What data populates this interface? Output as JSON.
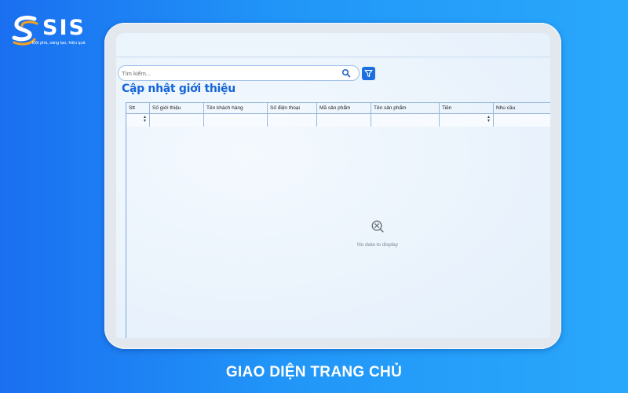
{
  "brand": {
    "name": "SIS",
    "slogan": "Đột phá, sáng tạo, hiệu quả",
    "color": "#ffffff"
  },
  "app": {
    "search": {
      "placeholder": "Tìm kiếm...",
      "value": ""
    },
    "page_title": "Cập nhật giới thiệu",
    "accent": "#1565d8",
    "table": {
      "columns": [
        "Stt",
        "Số giới thiệu",
        "Tên khách hàng",
        "Số điện thoại",
        "Mã sản phẩm",
        "Tên sản phẩm",
        "Tiền",
        "Nhu cầu"
      ],
      "empty_message": "No data to display"
    }
  },
  "caption": "GIAO DIỆN TRANG CHỦ"
}
